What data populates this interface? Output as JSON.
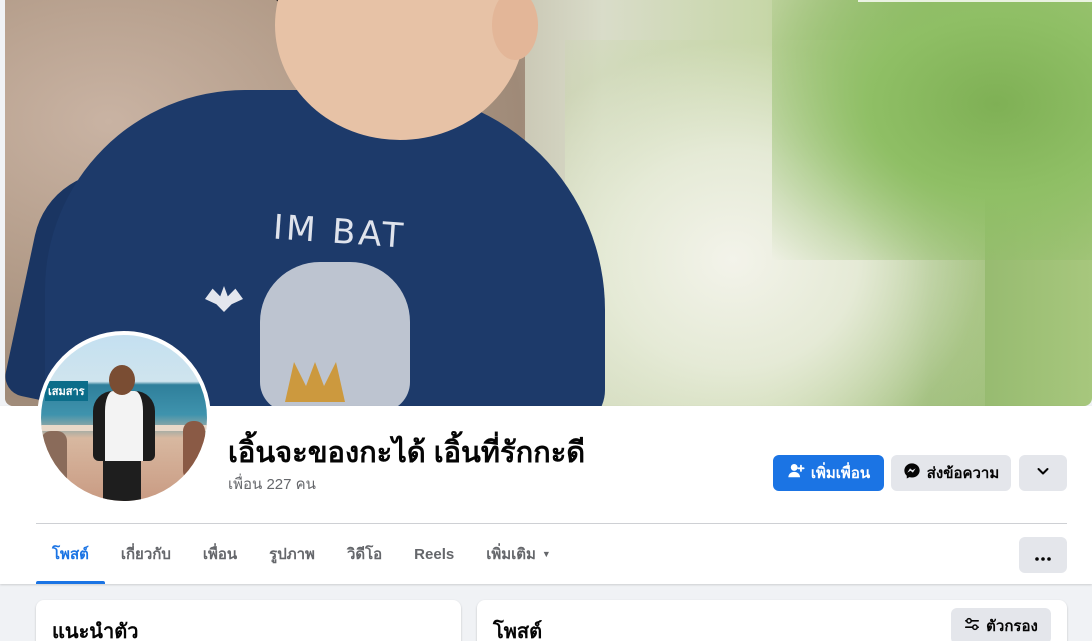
{
  "profile": {
    "name": "เอิ้นจะของกะได้ เอิ้นที่รักกะดี",
    "friends_count": "เพื่อน 227 คน",
    "cover_shirt_text": "IM BAT",
    "avatar_sign_text": "เสมสาร"
  },
  "actions": {
    "add_friend": "เพิ่มเพื่อน",
    "message": "ส่งข้อความ"
  },
  "tabs": [
    {
      "label": "โพสต์",
      "active": true
    },
    {
      "label": "เกี่ยวกับ",
      "active": false
    },
    {
      "label": "เพื่อน",
      "active": false
    },
    {
      "label": "รูปภาพ",
      "active": false
    },
    {
      "label": "วิดีโอ",
      "active": false
    },
    {
      "label": "Reels",
      "active": false
    },
    {
      "label": "เพิ่มเติม",
      "active": false
    }
  ],
  "cards": {
    "intro_title": "แนะนำตัว",
    "posts_title": "โพสต์",
    "filter_label": "ตัวกรอง"
  },
  "icons": {
    "add_friend": "person-plus-icon",
    "message": "messenger-icon",
    "chevron": "chevron-down-icon",
    "more": "more-horizontal-icon",
    "filter": "filter-sliders-icon",
    "tab_caret": "caret-down-icon"
  },
  "colors": {
    "primary": "#1b74e4",
    "secondary_bg": "#e4e6eb",
    "page_bg": "#f0f2f5",
    "muted_text": "#65676b"
  }
}
